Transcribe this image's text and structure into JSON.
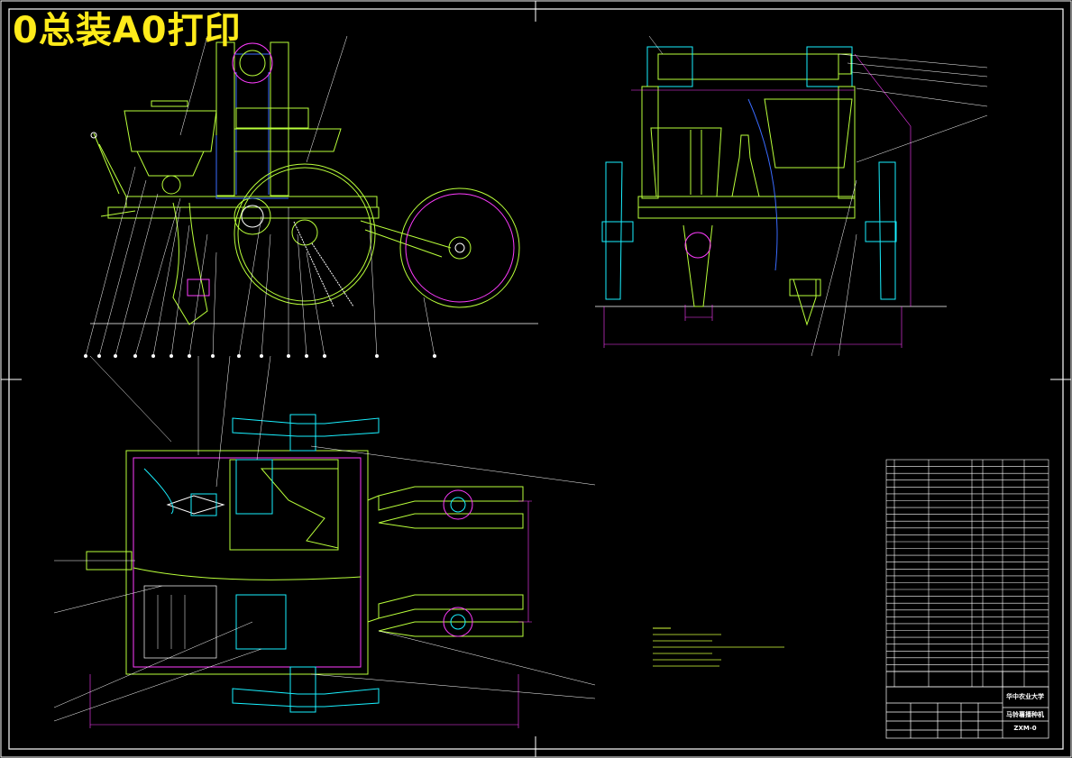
{
  "drawing_title": "0总装A0打印",
  "title_block": {
    "school": "华中农业大学",
    "machine_name": "马铃薯播种机",
    "drawing_no": "ZXM-0"
  },
  "colors": {
    "background": "#000000",
    "frame": "#ffffff",
    "outline_green": "#b9ff3a",
    "outline_cyan": "#19f0ff",
    "outline_magenta": "#ff3cff",
    "outline_blue": "#3a6bff",
    "title_yellow": "#ffeb1a"
  }
}
